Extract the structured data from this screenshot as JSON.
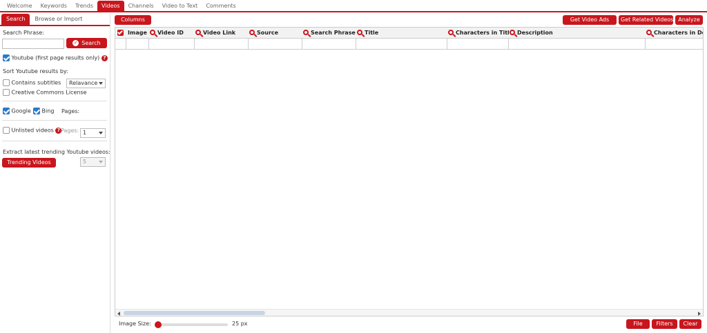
{
  "topnav": {
    "tabs": [
      {
        "label": "Welcome"
      },
      {
        "label": "Keywords"
      },
      {
        "label": "Trends"
      },
      {
        "label": "Videos",
        "active": true
      },
      {
        "label": "Channels"
      },
      {
        "label": "Video to Text"
      },
      {
        "label": "Comments"
      }
    ]
  },
  "left": {
    "subtabs": {
      "search": "Search",
      "browse": "Browse or Import"
    },
    "search_phrase_label": "Search Phrase:",
    "search_input_value": "",
    "search_button": "Search",
    "youtube_checkbox_label": "Youtube (first page results only)",
    "youtube_checked": true,
    "sort_label": "Sort Youtube results by:",
    "sort_value": "Relavance",
    "contains_subtitles": "Contains subtitles",
    "creative_commons": "Creative Commons License",
    "google_label": "Google",
    "bing_label": "Bing",
    "pages_label": "Pages:",
    "pages_value": "1",
    "unlisted_label": "Unlisted videos",
    "unlisted_pages_label": "Pages:",
    "unlisted_pages_value": "5",
    "trending_label": "Extract latest trending Youtube videos:",
    "trending_button": "Trending Videos"
  },
  "toolbar": {
    "columns": "Columns",
    "get_video_ads": "Get Video Ads",
    "get_related_videos": "Get Related Videos",
    "analyze": "Analyze"
  },
  "grid": {
    "columns": [
      {
        "label": "Image",
        "search": false
      },
      {
        "label": "Video ID",
        "search": true
      },
      {
        "label": "Video Link",
        "search": true
      },
      {
        "label": "Source",
        "search": true
      },
      {
        "label": "Search Phrase",
        "search": true
      },
      {
        "label": "Title",
        "search": true
      },
      {
        "label": "Characters in Title",
        "search": true
      },
      {
        "label": "Description",
        "search": true
      },
      {
        "label": "Characters in Desc",
        "search": true
      }
    ]
  },
  "footer": {
    "image_size_label": "Image Size:",
    "image_size_value": "25 px",
    "file": "File",
    "filters": "Filters",
    "clear": "Clear"
  },
  "colors": {
    "accent": "#c8161d",
    "check": "#2a7ac8"
  }
}
